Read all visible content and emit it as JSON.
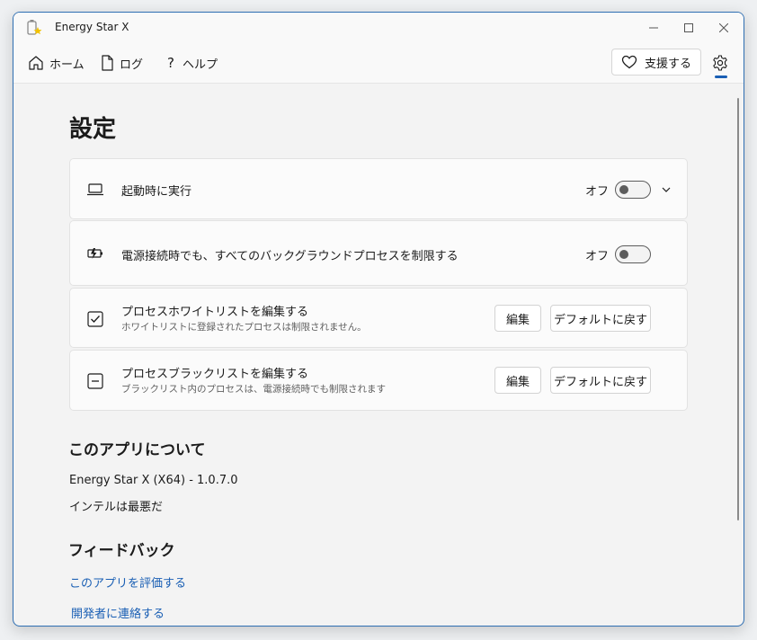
{
  "window": {
    "title": "Energy Star X"
  },
  "nav": {
    "home": "ホーム",
    "log": "ログ",
    "help": "ヘルプ",
    "support": "支援する"
  },
  "page": {
    "title": "設定"
  },
  "settings": [
    {
      "label": "起動時に実行",
      "state": "オフ",
      "icon": "laptop-icon",
      "toggle_on": false
    },
    {
      "label": "電源接続時でも、すべてのバックグラウンドプロセスを制限する",
      "state": "オフ",
      "icon": "battery-charging-icon",
      "toggle_on": false
    },
    {
      "label": "プロセスホワイトリストを編集する",
      "sublabel": "ホワイトリストに登録されたプロセスは制限されません。",
      "edit": "編集",
      "reset": "デフォルトに戻す",
      "icon": "checkbox-checked-icon"
    },
    {
      "label": "プロセスブラックリストを編集する",
      "sublabel": "ブラックリスト内のプロセスは、電源接続時でも制限されます",
      "edit": "編集",
      "reset": "デフォルトに戻す",
      "icon": "checkbox-minus-icon"
    }
  ],
  "about": {
    "title": "このアプリについて",
    "version": "Energy Star X (X64) - 1.0.7.0",
    "tagline": "インテルは最悪だ"
  },
  "feedback": {
    "title": "フィードバック",
    "rate": "このアプリを評価する",
    "contact": "開発者に連絡する"
  },
  "colors": {
    "accent": "#1a5fb4",
    "link": "#1a5fb4",
    "background": "#f3f3f3",
    "card": "#fbfbfb"
  }
}
